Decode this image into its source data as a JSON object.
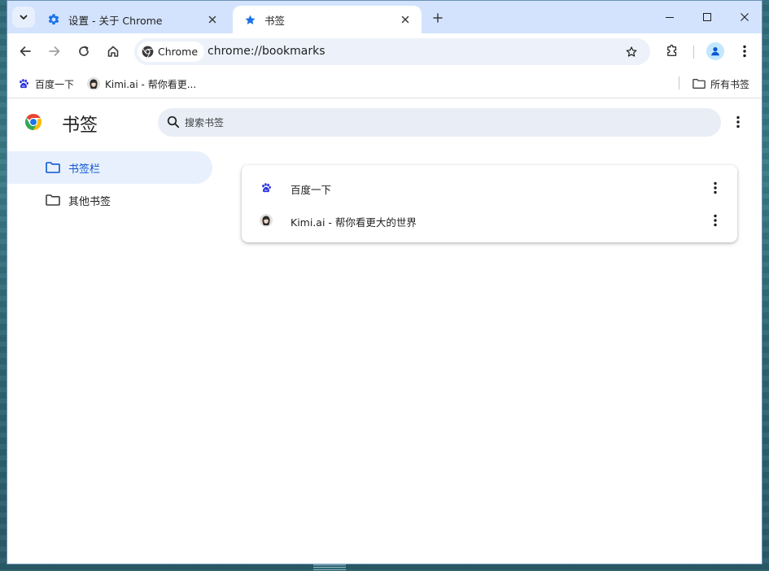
{
  "window": {
    "tabs": [
      {
        "title": "设置 - 关于 Chrome",
        "icon": "settings-gear-icon",
        "active": false
      },
      {
        "title": "书签",
        "icon": "star-icon",
        "active": true
      }
    ]
  },
  "toolbar": {
    "site_chip_label": "Chrome",
    "url": "chrome://bookmarks"
  },
  "bookmarks_bar": {
    "items": [
      {
        "label": "百度一下",
        "icon": "baidu-icon"
      },
      {
        "label": "Kimi.ai - 帮你看更...",
        "icon": "kimi-avatar-icon"
      }
    ],
    "all_bookmarks_label": "所有书签"
  },
  "bookmarks_page": {
    "title": "书签",
    "search_placeholder": "搜索书签",
    "sidebar": [
      {
        "label": "书签栏",
        "selected": true
      },
      {
        "label": "其他书签",
        "selected": false
      }
    ],
    "list": [
      {
        "title": "百度一下",
        "icon": "baidu-icon"
      },
      {
        "title": "Kimi.ai - 帮你看更大的世界",
        "icon": "kimi-avatar-icon"
      }
    ]
  },
  "colors": {
    "titlebar": "#d3e3fd",
    "accent": "#0b57d0",
    "selected_bg": "#e8f0fe",
    "search_bg": "#e9eef6"
  }
}
